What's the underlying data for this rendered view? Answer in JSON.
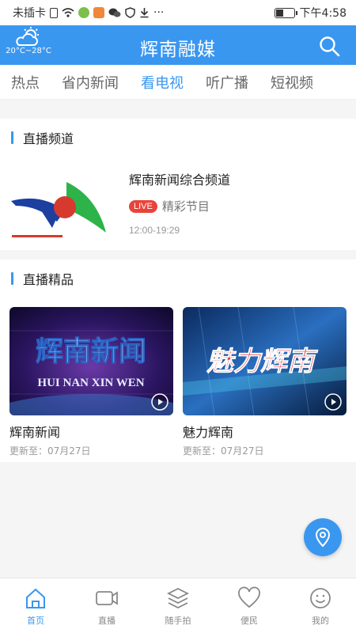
{
  "status_bar": {
    "carrier": "未插卡",
    "time": "下午4:58",
    "more": "···"
  },
  "header": {
    "title": "辉南融媒",
    "weather_temp": "20°C~28°C"
  },
  "tabs": [
    {
      "label": "热点",
      "active": false
    },
    {
      "label": "省内新闻",
      "active": false
    },
    {
      "label": "看电视",
      "active": true
    },
    {
      "label": "听广播",
      "active": false
    },
    {
      "label": "短视频",
      "active": false
    }
  ],
  "live_channels": {
    "section_title": "直播频道",
    "channel": {
      "name": "辉南新闻综合频道",
      "badge": "LIVE",
      "program": "精彩节目",
      "time": "12:00-19:29"
    }
  },
  "featured": {
    "section_title": "直播精品",
    "items": [
      {
        "title": "辉南新闻",
        "update": "更新至：07月27日",
        "thumb_title": "辉南新闻",
        "thumb_subtitle": "HUI NAN XIN WEN"
      },
      {
        "title": "魅力辉南",
        "update": "更新至：07月27日",
        "thumb_title": "魅力辉南"
      }
    ]
  },
  "bottom_nav": [
    {
      "label": "首页",
      "icon": "home-icon",
      "active": true
    },
    {
      "label": "直播",
      "icon": "video-camera-icon",
      "active": false
    },
    {
      "label": "随手拍",
      "icon": "layers-icon",
      "active": false
    },
    {
      "label": "便民",
      "icon": "heart-icon",
      "active": false
    },
    {
      "label": "我的",
      "icon": "smiley-icon",
      "active": false
    }
  ],
  "colors": {
    "primary": "#3a97f0",
    "live_red": "#e8443a"
  }
}
